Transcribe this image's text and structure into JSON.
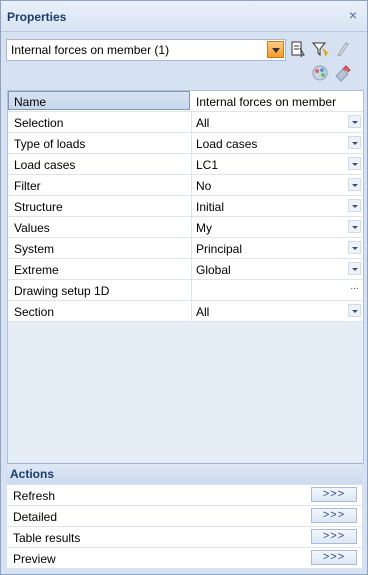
{
  "panel": {
    "title": "Properties",
    "close_label": "×"
  },
  "selector": {
    "value": "Internal forces on member (1)"
  },
  "properties": {
    "header_name": "Name",
    "header_value": "Internal forces on member",
    "rows": [
      {
        "label": "Selection",
        "value": "All"
      },
      {
        "label": "Type of loads",
        "value": "Load cases"
      },
      {
        "label": "Load cases",
        "value": "LC1"
      },
      {
        "label": "Filter",
        "value": "No"
      },
      {
        "label": "Structure",
        "value": "Initial"
      },
      {
        "label": "Values",
        "value": "My"
      },
      {
        "label": "System",
        "value": "Principal"
      },
      {
        "label": "Extreme",
        "value": "Global"
      },
      {
        "label": "Drawing setup 1D",
        "value": ""
      },
      {
        "label": "Section",
        "value": "All"
      }
    ]
  },
  "actions": {
    "title": "Actions",
    "items": [
      {
        "label": "Refresh",
        "button": ">>>"
      },
      {
        "label": "Detailed",
        "button": ">>>"
      },
      {
        "label": "Table results",
        "button": ">>>"
      },
      {
        "label": "Preview",
        "button": ">>>"
      }
    ]
  }
}
